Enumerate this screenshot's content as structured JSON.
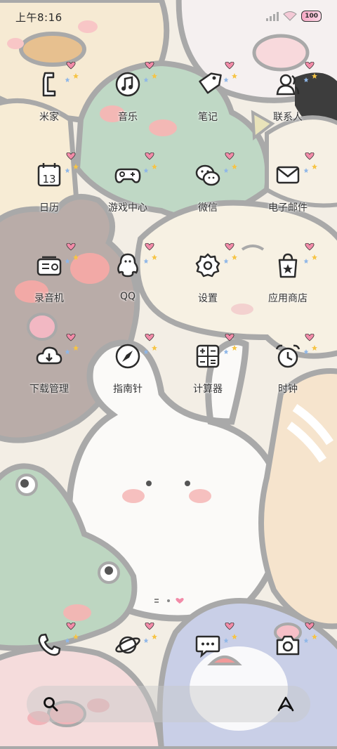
{
  "status": {
    "time": "上午8:16",
    "battery": "100"
  },
  "apps": [
    {
      "label": "米家",
      "icon": "mijia-icon"
    },
    {
      "label": "音乐",
      "icon": "music-icon"
    },
    {
      "label": "笔记",
      "icon": "notes-tag-icon"
    },
    {
      "label": "联系人",
      "icon": "contacts-icon"
    },
    {
      "label": "日历",
      "icon": "calendar-icon",
      "calendar_day": "13"
    },
    {
      "label": "游戏中心",
      "icon": "gamepad-icon"
    },
    {
      "label": "微信",
      "icon": "wechat-icon"
    },
    {
      "label": "电子邮件",
      "icon": "mail-icon"
    },
    {
      "label": "录音机",
      "icon": "recorder-icon"
    },
    {
      "label": "QQ",
      "icon": "qq-penguin-icon"
    },
    {
      "label": "设置",
      "icon": "gear-icon"
    },
    {
      "label": "应用商店",
      "icon": "store-bag-icon"
    },
    {
      "label": "下载管理",
      "icon": "cloud-download-icon"
    },
    {
      "label": "指南针",
      "icon": "compass-icon"
    },
    {
      "label": "计算器",
      "icon": "calculator-icon"
    },
    {
      "label": "时钟",
      "icon": "alarm-clock-icon"
    }
  ],
  "dock": [
    {
      "icon": "phone-icon"
    },
    {
      "icon": "browser-planet-icon"
    },
    {
      "icon": "messages-icon"
    },
    {
      "icon": "camera-icon"
    }
  ],
  "colors": {
    "icon_stroke": "#2b2b2b",
    "deco_heart": "#f28ba8",
    "deco_star": "#f6c445"
  }
}
